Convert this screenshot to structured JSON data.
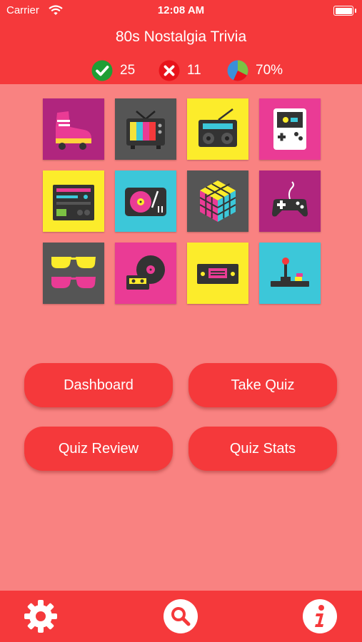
{
  "status_bar": {
    "carrier": "Carrier",
    "time": "12:08 AM"
  },
  "header": {
    "title": "80s Nostalgia Trivia"
  },
  "stats": {
    "correct": "25",
    "wrong": "11",
    "percent": "70%"
  },
  "colors": {
    "primary": "#f5393b",
    "background": "#f98281",
    "correct": "#1e9e35",
    "wrong": "#e8131b"
  },
  "tiles": [
    "roller-skate-icon",
    "tv-icon",
    "radio-icon",
    "handheld-game-icon",
    "stereo-icon",
    "turntable-icon",
    "rubiks-cube-icon",
    "gamepad-icon",
    "sunglasses-icon",
    "vinyl-cassette-icon",
    "vhs-tape-icon",
    "joystick-icon"
  ],
  "buttons": {
    "dashboard": "Dashboard",
    "take_quiz": "Take Quiz",
    "quiz_review": "Quiz Review",
    "quiz_stats": "Quiz Stats"
  },
  "tabbar": {
    "items": [
      "gear-icon",
      "search-icon",
      "info-icon"
    ]
  }
}
